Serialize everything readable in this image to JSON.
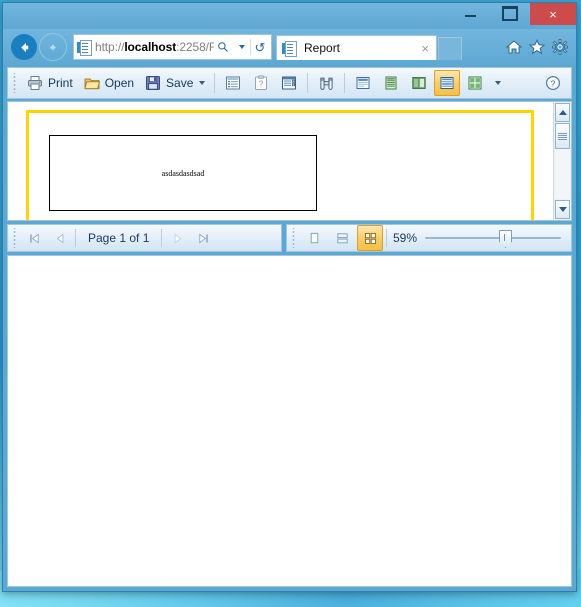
{
  "window": {
    "minimize_label": "Minimize",
    "maximize_label": "Maximize",
    "close_label": "×"
  },
  "navigation": {
    "back_label": "Back",
    "forward_label": "Forward",
    "url_protocol": "http://",
    "url_host": "localhost",
    "url_rest": ":2258/F",
    "url_full": "http://localhost:2258/F",
    "search_icon": "search-icon",
    "dropdown_icon": "chevron-down-icon",
    "refresh_icon": "refresh-icon",
    "refresh_glyph": "↺"
  },
  "tabs": [
    {
      "title": "Report",
      "close_label": "×",
      "icon": "page-icon",
      "active": true
    }
  ],
  "browser_icons": [
    {
      "name": "home-icon",
      "glyph": "⌂"
    },
    {
      "name": "favorites-star-icon",
      "glyph": "★"
    },
    {
      "name": "settings-gear-icon",
      "glyph": "⚙"
    }
  ],
  "toolbar": {
    "print_label": "Print",
    "open_label": "Open",
    "save_label": "Save",
    "save_has_dropdown": true,
    "buttons": [
      {
        "name": "document-map-button",
        "tooltip": "Document Map"
      },
      {
        "name": "report-properties-button",
        "tooltip": "Properties"
      },
      {
        "name": "parameters-panel-button",
        "tooltip": "Parameters"
      },
      {
        "name": "find-button",
        "tooltip": "Find",
        "glyph": "ش"
      },
      {
        "name": "page-view-single-button",
        "tooltip": "Single Page",
        "active": false
      },
      {
        "name": "page-view-continuous-button",
        "tooltip": "Continuous",
        "active": false
      },
      {
        "name": "page-view-facing-button",
        "tooltip": "Two Page",
        "active": false
      },
      {
        "name": "page-view-stacked-button",
        "tooltip": "Stacked",
        "active": true
      },
      {
        "name": "page-layout-grid-button",
        "tooltip": "Page Layout",
        "active": false,
        "has_dropdown": true
      }
    ],
    "help_label": "?",
    "help_icon": "help-circle-icon"
  },
  "report": {
    "page_border_color": "#ffd400",
    "textbox_value": "asdasdasdsad"
  },
  "pager": {
    "first_label": "First Page",
    "prev_label": "Previous Page",
    "page_text": "Page 1 of 1",
    "current_page": 1,
    "total_pages": 1,
    "next_label": "Next Page",
    "last_label": "Last Page"
  },
  "zoom": {
    "view_single_label": "Single page view",
    "view_double_label": "Two page view",
    "view_grid_label": "Page grid view",
    "active_view": "view_grid",
    "value_text": "59%",
    "value": 59,
    "min": 10,
    "max": 400
  },
  "scrollbar": {
    "up_label": "Scroll up",
    "down_label": "Scroll down",
    "thumb_label": "Vertical scroll thumb"
  }
}
